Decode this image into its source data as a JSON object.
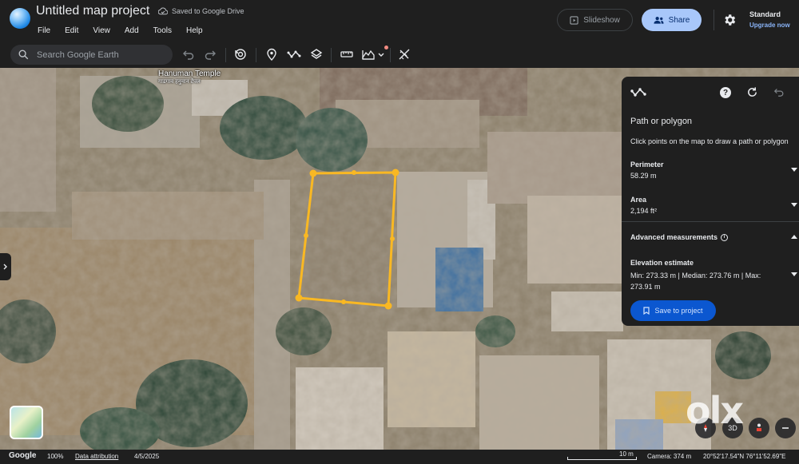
{
  "header": {
    "title": "Untitled map project",
    "saved_status": "Saved to Google Drive",
    "menu": [
      "File",
      "Edit",
      "View",
      "Add",
      "Tools",
      "Help"
    ],
    "slideshow_label": "Slideshow",
    "share_label": "Share",
    "plan_name": "Standard",
    "upgrade_label": "Upgrade now"
  },
  "toolbar": {
    "search_placeholder": "Search Google Earth",
    "icons": [
      "undo-icon",
      "redo-icon",
      "history-icon",
      "placemark-icon",
      "path-icon",
      "layers-icon",
      "ruler-icon",
      "elevation-profile-icon",
      "measure-icon"
    ]
  },
  "map": {
    "place_label": "Hanuman Temple",
    "place_label_local": "गाडगाव हनुमान टेंपल",
    "watermark": "olx",
    "view_3d_label": "3D"
  },
  "panel": {
    "title": "Path or polygon",
    "hint": "Click points on the map to draw a path or polygon",
    "perimeter_label": "Perimeter",
    "perimeter_value": "58.29 m",
    "area_label": "Area",
    "area_value": "2,194 ft²",
    "advanced_label": "Advanced measurements",
    "elevation_label": "Elevation estimate",
    "elevation_value": "Min: 273.33 m | Median: 273.76 m | Max: 273.91 m",
    "save_label": "Save to project"
  },
  "footer": {
    "brand": "Google",
    "zoom": "100%",
    "attribution": "Data attribution",
    "date": "4/5/2025",
    "scale": "10 m",
    "camera": "Camera: 374 m",
    "coords": "20°52'17.54\"N 76°11'52.69\"E"
  },
  "colors": {
    "accent": "#a8c7fa",
    "polygon": "#f9b823",
    "save_button": "#0b57d0",
    "panel_bg": "#1f1f1f"
  }
}
